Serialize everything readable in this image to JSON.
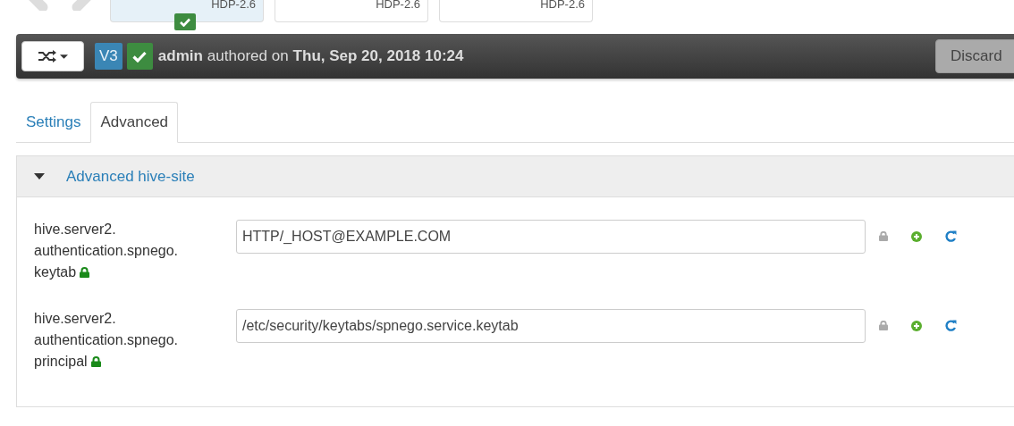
{
  "versions": [
    {
      "label": "HDP-2.6",
      "selected": true,
      "current": true
    },
    {
      "label": "HDP-2.6",
      "selected": false,
      "current": false
    },
    {
      "label": "HDP-2.6",
      "selected": false,
      "current": false
    }
  ],
  "toolbar": {
    "version": "V3",
    "author": "admin",
    "authored_text": "authored on",
    "date": "Thu, Sep 20, 2018 10:24",
    "discard": "Discard"
  },
  "tabs": [
    {
      "label": "Settings",
      "selected": false
    },
    {
      "label": "Advanced",
      "selected": true
    }
  ],
  "section": {
    "title": "Advanced hive-site",
    "expanded": true,
    "properties": [
      {
        "name_lines": [
          "hive.server2.",
          "authentication.spnego.",
          "keytab"
        ],
        "final": true,
        "value": "HTTP/_HOST@EXAMPLE.COM"
      },
      {
        "name_lines": [
          "hive.server2.",
          "authentication.spnego.",
          "principal"
        ],
        "final": true,
        "value": "/etc/security/keytabs/spnego.service.keytab"
      }
    ]
  }
}
